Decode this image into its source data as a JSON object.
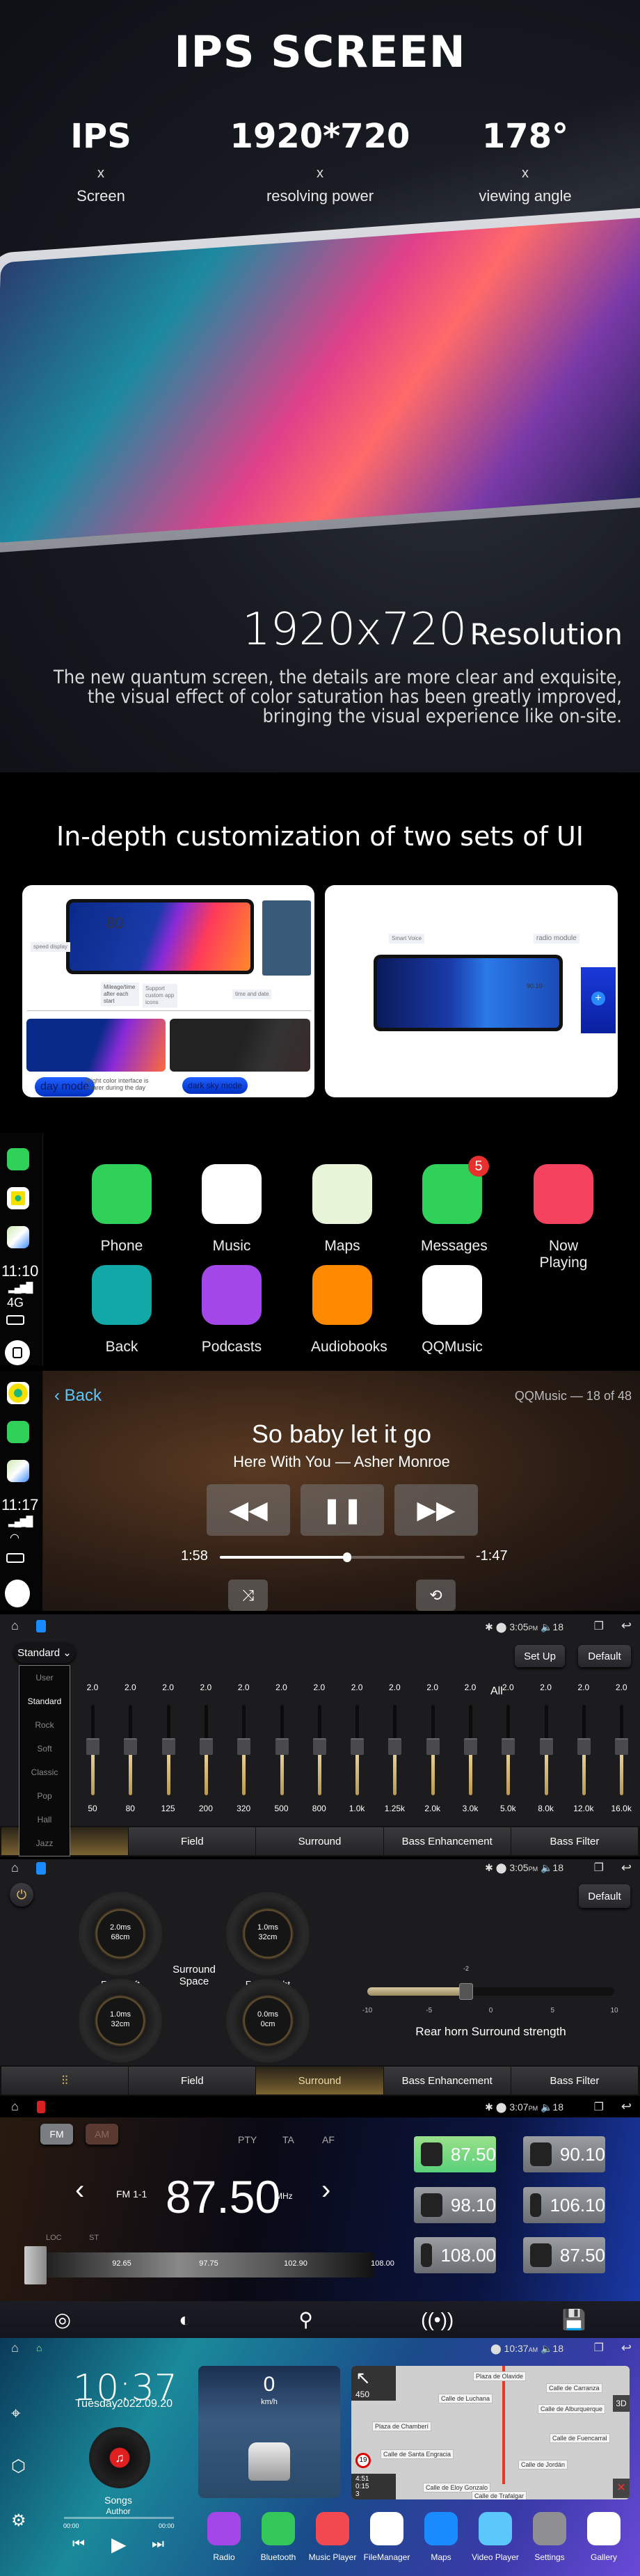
{
  "hero": {
    "title": "IPS SCREEN",
    "specs": [
      {
        "value": "IPS",
        "x": "x",
        "label": "Screen"
      },
      {
        "value": "1920*720",
        "x": "x",
        "label": "resolving power"
      },
      {
        "value": "178°",
        "x": "x",
        "label": "viewing angle"
      }
    ],
    "resolution_number": "1920x720",
    "resolution_word": "Resolution",
    "description": "The new quantum screen, the details are more clear and exquisite, the visual effect of color saturation has been greatly improved, bringing the visual experience like on-site."
  },
  "customization": {
    "title": "In-depth customization of two sets of UI",
    "left_panel": {
      "speed": "80",
      "speed_display": "speed display",
      "mileage": "Mileage/time after each start",
      "custom_icons": "Support custom app icons",
      "time_date": "time and date",
      "day_mode": "day mode",
      "day_desc": "Bright color interface is clearer during the day",
      "dark_mode": "dark sky mode"
    },
    "right_panel": {
      "smart_voice": "Smart Voice",
      "radio_module": "radio module",
      "radio_freq": "90.10"
    }
  },
  "carplay": {
    "sidebar": {
      "time": "11:10",
      "network": "4G"
    },
    "apps": [
      {
        "label": "Phone",
        "icon": "phone-icon",
        "color": "#2fd158"
      },
      {
        "label": "Music",
        "icon": "music-note-icon",
        "color": "#ffffff"
      },
      {
        "label": "Maps",
        "icon": "maps-icon",
        "color": "#e8f4d8"
      },
      {
        "label": "Messages",
        "icon": "message-bubble-icon",
        "color": "#2fd158",
        "badge": "5"
      },
      {
        "label": "Now Playing",
        "icon": "play-icon",
        "color": "#f5425f"
      },
      {
        "label": "Back",
        "icon": "car-phone-icon",
        "color": "#12a8a8"
      },
      {
        "label": "Podcasts",
        "icon": "podcast-icon",
        "color": "#a347e8"
      },
      {
        "label": "Audiobooks",
        "icon": "book-icon",
        "color": "#ff8a00"
      },
      {
        "label": "QQMusic",
        "icon": "qqmusic-icon",
        "color": "#ffffff"
      }
    ]
  },
  "now_playing": {
    "sidebar_time": "11:17",
    "back_label": "Back",
    "source": "QQMusic — 18 of 48",
    "title": "So baby let it go",
    "subtitle": "Here With You — Asher Monroe",
    "elapsed": "1:58",
    "remaining": "-1:47",
    "progress_percent": 52,
    "accent": "#5ac8fa"
  },
  "status_bar": {
    "time_eq": "3:05",
    "ampm_eq": "PM",
    "volume": "18",
    "time_radio": "3:07",
    "time_home": "10:37",
    "ampm_home": "AM"
  },
  "equalizer": {
    "preset": "Standard",
    "all_label": "All",
    "setup_label": "Set Up",
    "default_label": "Default",
    "preset_options": [
      "User",
      "Standard",
      "Rock",
      "Soft",
      "Classic",
      "Pop",
      "Hall",
      "Jazz"
    ],
    "bands": [
      {
        "freq": "50",
        "value": "2.0"
      },
      {
        "freq": "80",
        "value": "2.0"
      },
      {
        "freq": "125",
        "value": "2.0"
      },
      {
        "freq": "200",
        "value": "2.0"
      },
      {
        "freq": "320",
        "value": "2.0"
      },
      {
        "freq": "500",
        "value": "2.0"
      },
      {
        "freq": "800",
        "value": "2.0"
      },
      {
        "freq": "1.0k",
        "value": "2.0"
      },
      {
        "freq": "1.25k",
        "value": "2.0"
      },
      {
        "freq": "2.0k",
        "value": "2.0"
      },
      {
        "freq": "3.0k",
        "value": "2.0"
      },
      {
        "freq": "5.0k",
        "value": "2.0"
      },
      {
        "freq": "8.0k",
        "value": "2.0"
      },
      {
        "freq": "12.0k",
        "value": "2.0"
      },
      {
        "freq": "16.0k",
        "value": "2.0"
      }
    ],
    "tabs": [
      "",
      "Field",
      "Surround",
      "Bass Enhancement",
      "Bass Filter"
    ]
  },
  "surround": {
    "default_label": "Default",
    "center_label": "Surround Space",
    "dials": [
      {
        "name": "Front Left",
        "delay": "2.0ms",
        "distance": "68cm"
      },
      {
        "name": "Front Right",
        "delay": "1.0ms",
        "distance": "32cm"
      },
      {
        "name": "Rear Left",
        "delay": "1.0ms",
        "distance": "32cm"
      },
      {
        "name": "Rear Right",
        "delay": "0.0ms",
        "distance": "0cm"
      }
    ],
    "strength_label": "Rear horn Surround strength",
    "strength_value": -2,
    "strength_value_label": "-2",
    "scale": [
      "-10",
      "-5",
      "0",
      "5",
      "10"
    ],
    "active_tab": "Surround"
  },
  "radio": {
    "bands": [
      "FM",
      "AM"
    ],
    "flags": [
      "PTY",
      "TA",
      "AF"
    ],
    "channel": "FM 1-1",
    "frequency": "87.50",
    "unit": "MHz",
    "loc": "LOC",
    "st": "ST",
    "scale": [
      "92.65",
      "97.75",
      "102.90",
      "108.00"
    ],
    "presets": [
      "87.50",
      "90.10",
      "98.10",
      "106.10",
      "108.00",
      "87.50"
    ],
    "active_preset_color": "#5ad07a"
  },
  "home": {
    "clock": "10:37",
    "day": "Tuesday",
    "date": "2022.09.20",
    "song": "Songs",
    "author": "Author",
    "time_start": "00:00",
    "time_end": "00:00",
    "speed": "0",
    "speed_unit": "km/h",
    "map": {
      "distance": "450",
      "speed_limit": "19",
      "eta": "4:51",
      "duration": "0:15",
      "remaining": "3",
      "mode": "3D",
      "streets": [
        "Plaza de Olavide",
        "Calle de Carranza",
        "Calle de Luchana",
        "Calle de Alburquerque",
        "Plaza de Chamberí",
        "Calle de Fuencarral",
        "Calle de Santa Engracia",
        "Calle de Jordán",
        "Calle de Eloy Gonzalo",
        "Calle de Trafalgar"
      ]
    },
    "apps": [
      {
        "label": "Radio",
        "color": "#a347e8"
      },
      {
        "label": "Bluetooth",
        "color": "#34c759"
      },
      {
        "label": "Music Player",
        "color": "#f2484f"
      },
      {
        "label": "FileManager",
        "color": "#ffffff"
      },
      {
        "label": "Maps",
        "color": "#1a8cff"
      },
      {
        "label": "Video Player",
        "color": "#5ac8fa"
      },
      {
        "label": "Settings",
        "color": "#8e8e93"
      },
      {
        "label": "Gallery",
        "color": "#ffffff"
      }
    ]
  }
}
